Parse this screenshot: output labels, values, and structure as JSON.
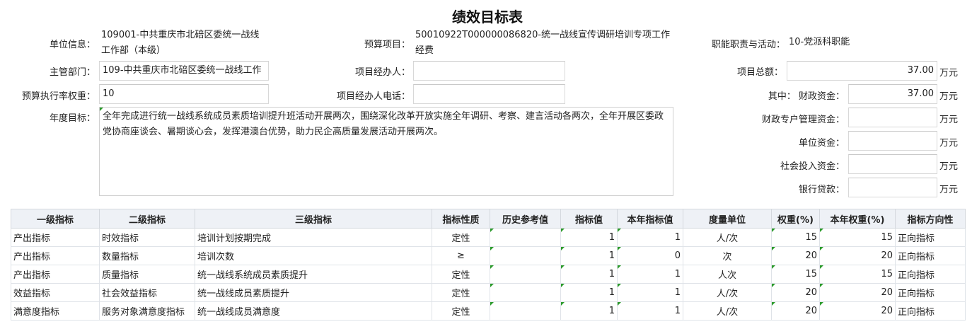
{
  "page": {
    "title": "绩效目标表"
  },
  "header": {
    "unit_info_label": "单位信息：",
    "unit_info_value_line1": "109001-中共重庆市北碚区委统一战线",
    "unit_info_value_line2": "工作部（本级）",
    "budget_project_label": "预算项目：",
    "budget_project_value_line1": "50010922T000000086820-统一战线宣传调研培训专项工作",
    "budget_project_value_line2": "经费",
    "function_label": "职能职责与活动：",
    "function_value": "10-党派科职能",
    "supervisor_label": "主管部门：",
    "supervisor_value": "109-中共重庆市北碚区委统一战线工作",
    "manager_label": "项目经办人：",
    "manager_value": "",
    "total_label": "项目总额：",
    "total_value": "37.00",
    "weight_label": "预算执行率权重：",
    "weight_value": "10",
    "manager_phone_label": "项目经办人电话：",
    "manager_phone_value": "",
    "fiscal_label": "其中：  财政资金：",
    "fiscal_value": "37.00",
    "special_label": "财政专户管理资金：",
    "special_value": "",
    "unit_fund_label": "单位资金：",
    "unit_fund_value": "",
    "social_label": "社会投入资金：",
    "social_value": "",
    "loan_label": "银行贷款：",
    "loan_value": "",
    "unit": "万元",
    "annual_goal_label": "年度目标：",
    "annual_goal_value": "全年完成进行统一战线系统成员素质培训提升班活动开展两次，围绕深化改革开放实施全年调研、考察、建言活动各两次，全年开展区委政党协商座谈会、暑期谈心会，发挥港澳台优势，助力民企高质量发展活动开展两次。"
  },
  "table": {
    "headers": [
      "一级指标",
      "二级指标",
      "三级指标",
      "指标性质",
      "历史参考值",
      "指标值",
      "本年指标值",
      "度量单位",
      "权重(%)",
      "本年权重(%)",
      "指标方向性"
    ],
    "rows": [
      [
        "产出指标",
        "时效指标",
        "培训计划按期完成",
        "定性",
        "",
        "1",
        "1",
        "人/次",
        "15",
        "15",
        "正向指标"
      ],
      [
        "产出指标",
        "数量指标",
        "培训次数",
        "≥",
        "",
        "1",
        "0",
        "次",
        "20",
        "20",
        "正向指标"
      ],
      [
        "产出指标",
        "质量指标",
        "统一战线系统成员素质提升",
        "定性",
        "",
        "1",
        "1",
        "人次",
        "15",
        "15",
        "正向指标"
      ],
      [
        "效益指标",
        "社会效益指标",
        "统一战线成员素质提升",
        "定性",
        "",
        "1",
        "1",
        "人/次",
        "20",
        "20",
        "正向指标"
      ],
      [
        "满意度指标",
        "服务对象满意度指标",
        "统一战线成员满意度",
        "定性",
        "",
        "1",
        "1",
        "人/次",
        "20",
        "20",
        "正向指标"
      ]
    ]
  }
}
